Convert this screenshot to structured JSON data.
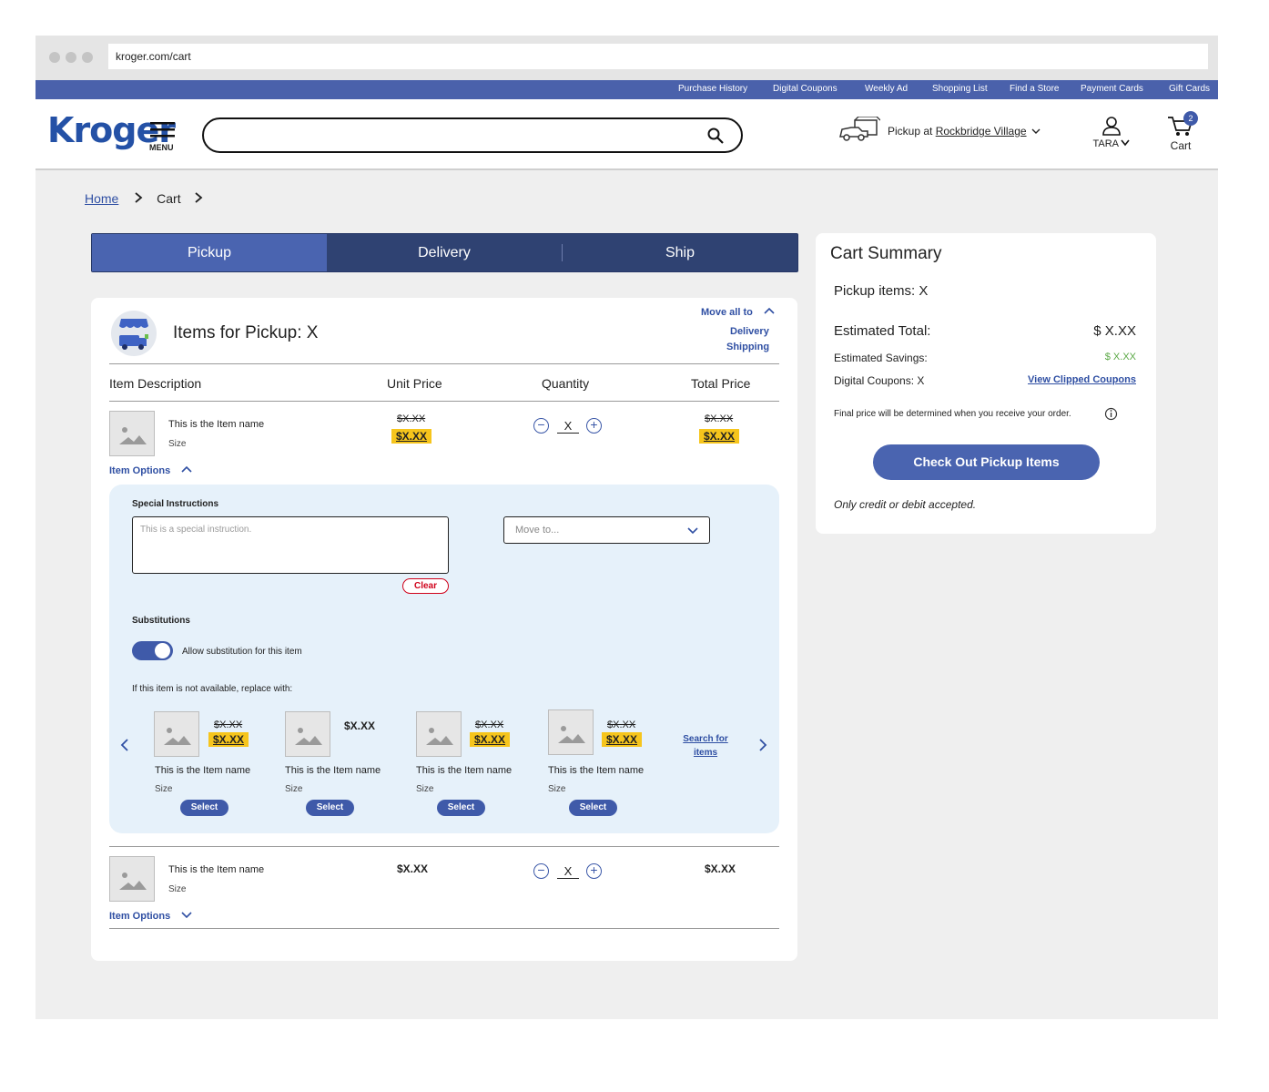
{
  "browser": {
    "url": "kroger.com/cart"
  },
  "top_nav": [
    "Purchase History",
    "Digital Coupons",
    "Weekly Ad",
    "Shopping List",
    "Find a Store",
    "Payment Cards",
    "Gift Cards"
  ],
  "header": {
    "logo": "Kroger",
    "menu_label": "MENU",
    "search_placeholder": "",
    "pickup_prefix": "Pickup at",
    "store_name": "Rockbridge Village",
    "user_name": "TARA",
    "cart_label": "Cart",
    "cart_count": "2"
  },
  "breadcrumb": {
    "home": "Home",
    "current": "Cart"
  },
  "tabs": [
    "Pickup",
    "Delivery",
    "Ship"
  ],
  "items_section": {
    "title": "Items for Pickup: X",
    "move_all_label": "Move all to",
    "move_targets": [
      "Delivery",
      "Shipping"
    ],
    "columns": [
      "Item Description",
      "Unit Price",
      "Quantity",
      "Total Price"
    ],
    "items": [
      {
        "name": "This is the Item name",
        "size": "Size",
        "unit_old": "$X.XX",
        "unit_sale": "$X.XX",
        "quantity": "X",
        "total_old": "$X.XX",
        "total_sale": "$X.XX",
        "options_label": "Item Options"
      },
      {
        "name": "This is the Item name",
        "size": "Size",
        "unit_price": "$X.XX",
        "quantity": "X",
        "total_price": "$X.XX",
        "options_label": "Item Options"
      }
    ],
    "options_panel": {
      "special_instructions_label": "Special Instructions",
      "special_instructions_placeholder": "This is a special instruction.",
      "clear_label": "Clear",
      "move_to_placeholder": "Move to...",
      "substitutions_label": "Substitutions",
      "allow_sub_label": "Allow substitution for this item",
      "replace_label": "If this item is not available, replace with:",
      "search_link": "Search for items",
      "substitutes": [
        {
          "name": "This is the Item name",
          "size": "Size",
          "old": "$X.XX",
          "sale": "$X.XX",
          "select": "Select"
        },
        {
          "name": "This is the Item name",
          "size": "Size",
          "price": "$X.XX",
          "select": "Select"
        },
        {
          "name": "This is the Item name",
          "size": "Size",
          "old": "$X.XX",
          "sale": "$X.XX",
          "select": "Select"
        },
        {
          "name": "This is the Item name",
          "size": "Size",
          "old": "$X.XX",
          "sale": "$X.XX",
          "select": "Select"
        }
      ]
    }
  },
  "summary": {
    "title": "Cart Summary",
    "pickup_items": "Pickup items: X",
    "est_total_label": "Estimated Total:",
    "est_total_value": "$ X.XX",
    "savings_label": "Estimated Savings:",
    "savings_value": "$ X.XX",
    "coupons_label": "Digital Coupons: X",
    "coupons_link": "View Clipped Coupons",
    "note": "Final price will be determined when you receive your order.",
    "checkout_label": "Check Out Pickup Items",
    "payment_note": "Only credit or debit accepted."
  },
  "colors": {
    "brand_blue": "#4a61ab",
    "tab_dark": "#2f4272",
    "sale_yellow": "#f6c51c",
    "savings_green": "#5aa845",
    "panel_bg": "#e6f1fa"
  },
  "icons": [
    "search-icon",
    "hamburger-icon",
    "truck-icon",
    "user-icon",
    "cart-icon",
    "chevron-down-icon",
    "chevron-up-icon",
    "chevron-right-icon",
    "chevron-left-icon",
    "info-icon",
    "image-placeholder-icon",
    "pickup-store-icon"
  ]
}
